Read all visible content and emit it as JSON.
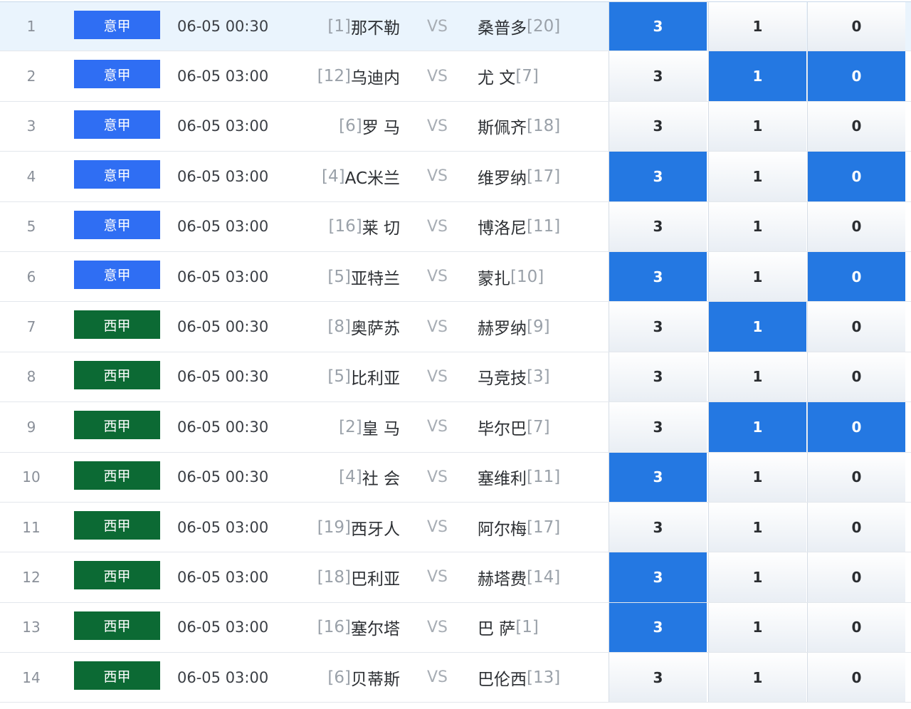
{
  "rows": [
    {
      "index": "1",
      "league": "意甲",
      "league_type": "it",
      "time": "06-05 00:30",
      "home_rank": "[1]",
      "home": "那不勒",
      "vs": "VS",
      "away": "桑普多",
      "away_rank": "[20]",
      "odds": [
        "3",
        "1",
        "0"
      ],
      "selected": [
        true,
        false,
        false
      ],
      "highlight": true
    },
    {
      "index": "2",
      "league": "意甲",
      "league_type": "it",
      "time": "06-05 03:00",
      "home_rank": "[12]",
      "home": "乌迪内",
      "vs": "VS",
      "away": "尤 文",
      "away_rank": "[7]",
      "odds": [
        "3",
        "1",
        "0"
      ],
      "selected": [
        false,
        true,
        true
      ],
      "highlight": false
    },
    {
      "index": "3",
      "league": "意甲",
      "league_type": "it",
      "time": "06-05 03:00",
      "home_rank": "[6]",
      "home": "罗 马",
      "vs": "VS",
      "away": "斯佩齐",
      "away_rank": "[18]",
      "odds": [
        "3",
        "1",
        "0"
      ],
      "selected": [
        false,
        false,
        false
      ],
      "highlight": false
    },
    {
      "index": "4",
      "league": "意甲",
      "league_type": "it",
      "time": "06-05 03:00",
      "home_rank": "[4]",
      "home": "AC米兰",
      "vs": "VS",
      "away": "维罗纳",
      "away_rank": "[17]",
      "odds": [
        "3",
        "1",
        "0"
      ],
      "selected": [
        true,
        false,
        true
      ],
      "highlight": false
    },
    {
      "index": "5",
      "league": "意甲",
      "league_type": "it",
      "time": "06-05 03:00",
      "home_rank": "[16]",
      "home": "莱 切",
      "vs": "VS",
      "away": "博洛尼",
      "away_rank": "[11]",
      "odds": [
        "3",
        "1",
        "0"
      ],
      "selected": [
        false,
        false,
        false
      ],
      "highlight": false
    },
    {
      "index": "6",
      "league": "意甲",
      "league_type": "it",
      "time": "06-05 03:00",
      "home_rank": "[5]",
      "home": "亚特兰",
      "vs": "VS",
      "away": "蒙扎",
      "away_rank": "[10]",
      "odds": [
        "3",
        "1",
        "0"
      ],
      "selected": [
        true,
        false,
        true
      ],
      "highlight": false
    },
    {
      "index": "7",
      "league": "西甲",
      "league_type": "es",
      "time": "06-05 00:30",
      "home_rank": "[8]",
      "home": "奥萨苏",
      "vs": "VS",
      "away": "赫罗纳",
      "away_rank": "[9]",
      "odds": [
        "3",
        "1",
        "0"
      ],
      "selected": [
        false,
        true,
        false
      ],
      "highlight": false
    },
    {
      "index": "8",
      "league": "西甲",
      "league_type": "es",
      "time": "06-05 00:30",
      "home_rank": "[5]",
      "home": "比利亚",
      "vs": "VS",
      "away": "马竞技",
      "away_rank": "[3]",
      "odds": [
        "3",
        "1",
        "0"
      ],
      "selected": [
        false,
        false,
        false
      ],
      "highlight": false
    },
    {
      "index": "9",
      "league": "西甲",
      "league_type": "es",
      "time": "06-05 00:30",
      "home_rank": "[2]",
      "home": "皇 马",
      "vs": "VS",
      "away": "毕尔巴",
      "away_rank": "[7]",
      "odds": [
        "3",
        "1",
        "0"
      ],
      "selected": [
        false,
        true,
        true
      ],
      "highlight": false
    },
    {
      "index": "10",
      "league": "西甲",
      "league_type": "es",
      "time": "06-05 00:30",
      "home_rank": "[4]",
      "home": "社 会",
      "vs": "VS",
      "away": "塞维利",
      "away_rank": "[11]",
      "odds": [
        "3",
        "1",
        "0"
      ],
      "selected": [
        true,
        false,
        false
      ],
      "highlight": false
    },
    {
      "index": "11",
      "league": "西甲",
      "league_type": "es",
      "time": "06-05 03:00",
      "home_rank": "[19]",
      "home": "西牙人",
      "vs": "VS",
      "away": "阿尔梅",
      "away_rank": "[17]",
      "odds": [
        "3",
        "1",
        "0"
      ],
      "selected": [
        false,
        false,
        false
      ],
      "highlight": false
    },
    {
      "index": "12",
      "league": "西甲",
      "league_type": "es",
      "time": "06-05 03:00",
      "home_rank": "[18]",
      "home": "巴利亚",
      "vs": "VS",
      "away": "赫塔费",
      "away_rank": "[14]",
      "odds": [
        "3",
        "1",
        "0"
      ],
      "selected": [
        true,
        false,
        false
      ],
      "highlight": false
    },
    {
      "index": "13",
      "league": "西甲",
      "league_type": "es",
      "time": "06-05 03:00",
      "home_rank": "[16]",
      "home": "塞尔塔",
      "vs": "VS",
      "away": "巴 萨",
      "away_rank": "[1]",
      "odds": [
        "3",
        "1",
        "0"
      ],
      "selected": [
        true,
        false,
        false
      ],
      "highlight": false
    },
    {
      "index": "14",
      "league": "西甲",
      "league_type": "es",
      "time": "06-05 03:00",
      "home_rank": "[6]",
      "home": "贝蒂斯",
      "vs": "VS",
      "away": "巴伦西",
      "away_rank": "[13]",
      "odds": [
        "3",
        "1",
        "0"
      ],
      "selected": [
        false,
        false,
        false
      ],
      "highlight": false
    }
  ]
}
